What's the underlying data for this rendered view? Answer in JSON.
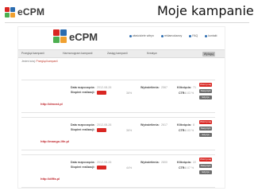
{
  "slide": {
    "logo_text": "eCPM",
    "title": "Moje kampanie"
  },
  "app": {
    "logo_text": "eCPM",
    "top_links": [
      "właściciele witryn",
      "reklamodawcy",
      "FAQ",
      "kontakt"
    ],
    "nav_tabs": [
      "Przegląd kampanii",
      "Harmonogram kampanii",
      "Zasięg kampanii",
      "Kreatyw"
    ],
    "nav_button": "Wyloguj",
    "breadcrumb_prefix": "Jesteś tutaj:",
    "breadcrumb_current": "Przegląd kampanii",
    "labels": {
      "start_date": "Data rozpoczęcia:",
      "progress": "Stopień realizacji:",
      "impressions": "Wyświetlenia:",
      "clicks": "Kliknięcia:",
      "ctr": "CTR:"
    },
    "campaigns": [
      {
        "start_date": "2012-08-26",
        "progress": "36%",
        "progress_value": 0.36,
        "impressions": "2567",
        "clicks": "71",
        "ctr": "0.03 %",
        "url": "http://dmost.pl",
        "buttons": [
          "Wstrzymaj",
          "Statystyki",
          "Edycja"
        ]
      },
      {
        "start_date": "2012-08-26",
        "progress": "36%",
        "progress_value": 0.36,
        "impressions": "2617",
        "clicks": "8",
        "ctr": "0.03 %",
        "url": "http://mango-life.pl",
        "buttons": [
          "Wstrzymaj",
          "Statystyki",
          "Edycja"
        ]
      },
      {
        "start_date": "2012-08-26",
        "progress": "44%",
        "progress_value": 0.44,
        "impressions": "2800",
        "clicks": "22",
        "ctr": "0.07 %",
        "url": "http://diffa.pl",
        "buttons": [
          "Wstrzymaj",
          "Statystyki",
          "Edycja"
        ]
      }
    ]
  },
  "colors": {
    "accent_red": "#d92622",
    "logo_blue": "#2b6cb0",
    "logo_green": "#4caf50",
    "logo_red": "#d92622",
    "logo_orange": "#f0a030"
  }
}
